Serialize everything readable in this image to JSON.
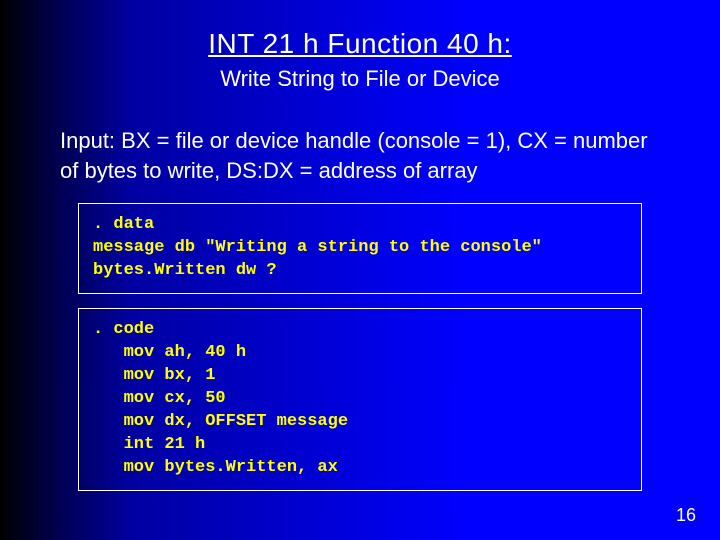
{
  "title": "INT 21 h Function 40 h:",
  "subtitle": "Write String to File or Device",
  "input_desc": "Input: BX = file or device handle (console = 1), CX = number of bytes to write, DS:DX = address of array",
  "code1": ". data\nmessage db \"Writing a string to the console\"\nbytes.Written dw ?",
  "code2": ". code\n   mov ah, 40 h\n   mov bx, 1\n   mov cx, 50\n   mov dx, OFFSET message\n   int 21 h\n   mov bytes.Written, ax",
  "page_number": "16"
}
